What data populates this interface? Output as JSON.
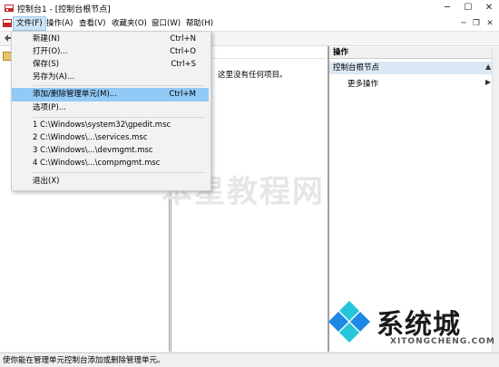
{
  "window": {
    "title": "控制台1 - [控制台根节点]",
    "minimize": "─",
    "maximize": "☐",
    "close": "✕"
  },
  "menubar": {
    "items": [
      "文件(F)",
      "操作(A)",
      "查看(V)",
      "收藏夹(O)",
      "窗口(W)",
      "帮助(H)"
    ],
    "mdi_minimize": "─",
    "mdi_restore": "❐",
    "mdi_close": "✕"
  },
  "file_menu": {
    "items": [
      {
        "label": "新建(N)",
        "shortcut": "Ctrl+N"
      },
      {
        "label": "打开(O)...",
        "shortcut": "Ctrl+O"
      },
      {
        "label": "保存(S)",
        "shortcut": "Ctrl+S"
      },
      {
        "label": "另存为(A)...",
        "shortcut": ""
      },
      {
        "label": "添加/删除管理单元(M)...",
        "shortcut": "Ctrl+M"
      },
      {
        "label": "选项(P)...",
        "shortcut": ""
      },
      {
        "label": "1 C:\\Windows\\system32\\gpedit.msc",
        "shortcut": ""
      },
      {
        "label": "2 C:\\Windows\\...\\services.msc",
        "shortcut": ""
      },
      {
        "label": "3 C:\\Windows\\...\\devmgmt.msc",
        "shortcut": ""
      },
      {
        "label": "4 C:\\Windows\\...\\compmgmt.msc",
        "shortcut": ""
      },
      {
        "label": "退出(X)",
        "shortcut": ""
      }
    ],
    "highlighted_index": 4
  },
  "center": {
    "empty_message": "这里没有任何项目。"
  },
  "actions_pane": {
    "header": "操作",
    "section": "控制台根节点",
    "more_actions": "更多操作",
    "section_arrow": "▲",
    "more_arrow": "▶"
  },
  "statusbar": {
    "text": "使你能在管理单元控制台添加或删除管理单元。"
  },
  "watermark": {
    "center_text": "本星教程网",
    "brand": "系统城",
    "domain": "XITONGCHENG.COM"
  },
  "colors": {
    "highlight": "#91c9f7",
    "section_bg": "#dbe8f5",
    "logo_blue": "#1e88e5",
    "logo_cyan": "#26c6da"
  }
}
